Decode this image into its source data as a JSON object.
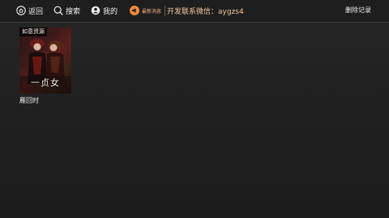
{
  "nav": {
    "back_label": "返回",
    "search_label": "搜索",
    "mine_label": "我的"
  },
  "news": {
    "tag_label": "最新消息",
    "ticker_text": "开发联系微信：aygzs4",
    "accent_color": "#f08a3c"
  },
  "actions": {
    "delete_record_label": "删除记录"
  },
  "history": {
    "items": [
      {
        "source_badge": "如意资源",
        "poster_title": "一贞女",
        "title": "雁回时"
      }
    ]
  }
}
